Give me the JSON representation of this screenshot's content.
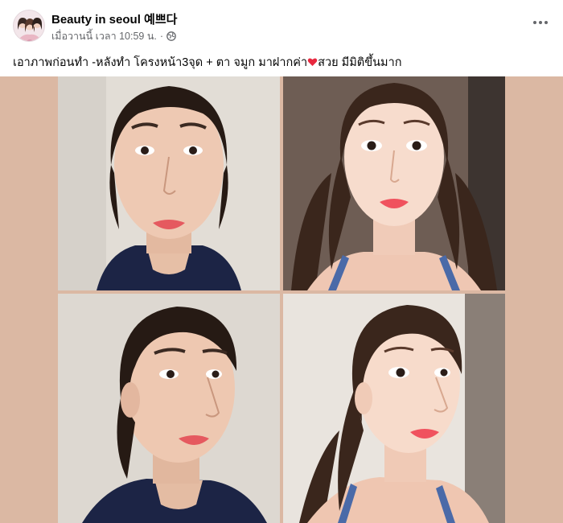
{
  "post": {
    "page_name": "Beauty in seoul 예쁘다",
    "timestamp": "เมื่อวานนี้ เวลา 10:59 น.",
    "separator": "·",
    "caption_part1": "เอาภาพก่อนทำ -หลังทำ โครงหน้า3จุด + ตา จมูก มาฝากค่า",
    "caption_part2": "สวย มีมิติขึ้นมาก",
    "icons": {
      "privacy": "globe-icon",
      "more": "more-icon",
      "emoji": "heart-icon"
    }
  },
  "colors": {
    "media_background": "#dbb8a3",
    "heart": "#e8283f",
    "meta_text": "#65676b"
  }
}
